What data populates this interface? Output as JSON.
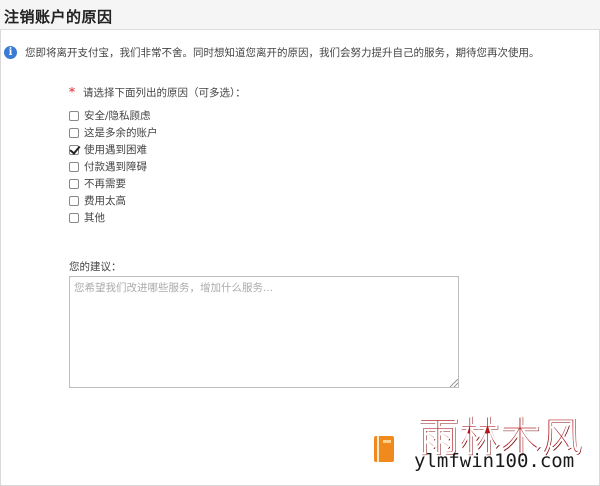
{
  "header": {
    "title": "注销账户的原因"
  },
  "notice": {
    "icon": "info-icon",
    "text": "您即将离开支付宝，我们非常不舍。同时想知道您离开的原因，我们会努力提升自己的服务，期待您再次使用。"
  },
  "reasons": {
    "required_mark": "*",
    "label": "请选择下面列出的原因（可多选）：",
    "items": [
      {
        "label": "安全/隐私顾虑",
        "checked": false
      },
      {
        "label": "这是多余的账户",
        "checked": false
      },
      {
        "label": "使用遇到困难",
        "checked": true
      },
      {
        "label": "付款遇到障碍",
        "checked": false
      },
      {
        "label": "不再需要",
        "checked": false
      },
      {
        "label": "费用太高",
        "checked": false
      },
      {
        "label": "其他",
        "checked": false
      }
    ]
  },
  "suggestion": {
    "label": "您的建议：",
    "value": "",
    "placeholder": "您希望我们改进哪些服务，增加什么服务..."
  },
  "watermark": {
    "brand_cn": "雨林木风",
    "url": "ylmfwin100.com",
    "colors": {
      "brand": "#b0181e",
      "book": "#f08a1c"
    }
  },
  "colors": {
    "info": "#3a7bd5",
    "required": "#e02020"
  }
}
